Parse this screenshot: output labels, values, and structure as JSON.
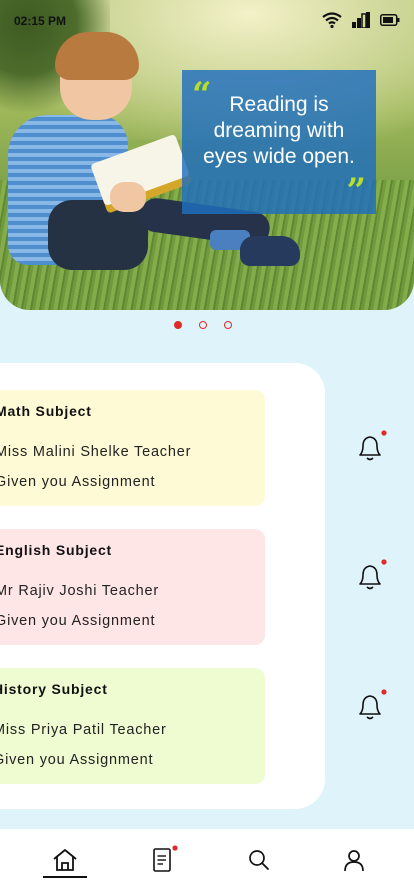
{
  "status_bar": {
    "time": "02:15 PM"
  },
  "hero": {
    "quote": "Reading is dreaming with eyes wide open."
  },
  "carousel": {
    "count": 3,
    "active": 0
  },
  "assignments": [
    {
      "subject": "Math Subject",
      "teacher": "Miss Malini Shelke Teacher",
      "message": "Given you Assignment",
      "bg": "#fffad6"
    },
    {
      "subject": "English Subject",
      "teacher": "Mr Rajiv Joshi Teacher",
      "message": "Given you Assignment",
      "bg": "#ffe6e6"
    },
    {
      "subject": "History Subject",
      "teacher": "Miss Priya Patil Teacher",
      "message": "Given you Assignment",
      "bg": "#effcd2"
    }
  ],
  "nav": [
    {
      "name": "home",
      "icon": "home-icon",
      "active": true
    },
    {
      "name": "assignments",
      "icon": "notes-icon",
      "badge": true
    },
    {
      "name": "search",
      "icon": "search-icon"
    },
    {
      "name": "profile",
      "icon": "user-icon"
    }
  ],
  "colors": {
    "accent": "#e02a2a",
    "background": "#dff3fb",
    "quote_box": "#1e6ebe"
  }
}
